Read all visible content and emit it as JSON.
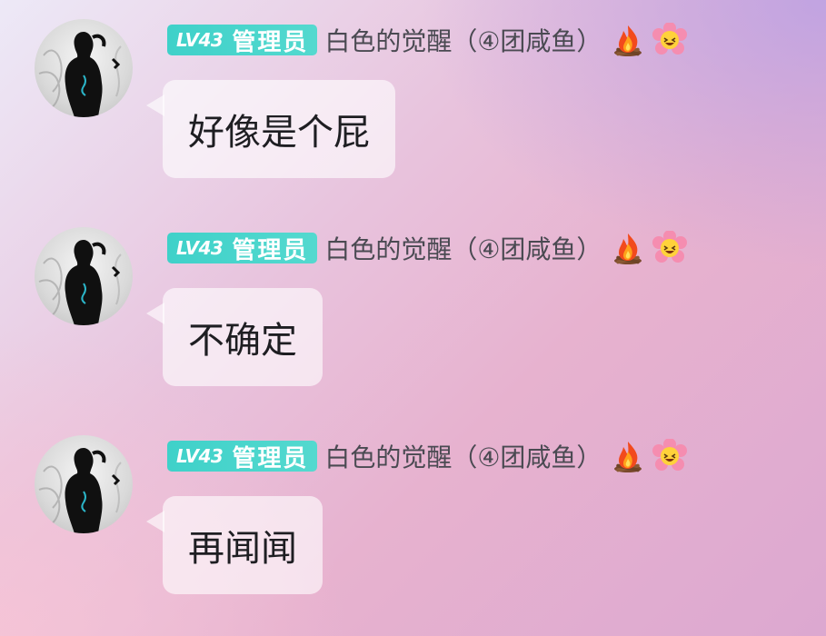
{
  "messages": [
    {
      "level": "LV43",
      "role": "管理员",
      "username": "白色的觉醒（④团咸鱼）",
      "text": "好像是个屁"
    },
    {
      "level": "LV43",
      "role": "管理员",
      "username": "白色的觉醒（④团咸鱼）",
      "text": "不确定"
    },
    {
      "level": "LV43",
      "role": "管理员",
      "username": "白色的觉醒（④团咸鱼）",
      "text": "再闻闻"
    }
  ],
  "icons": {
    "avatar": "avatar-silhouette-image",
    "emoji_1": "fire-icon",
    "emoji_2": "flower-face-icon"
  },
  "colors": {
    "badge": "#3fd1c9",
    "username": "#4a4a52",
    "bubble_text": "#1e1e22"
  }
}
